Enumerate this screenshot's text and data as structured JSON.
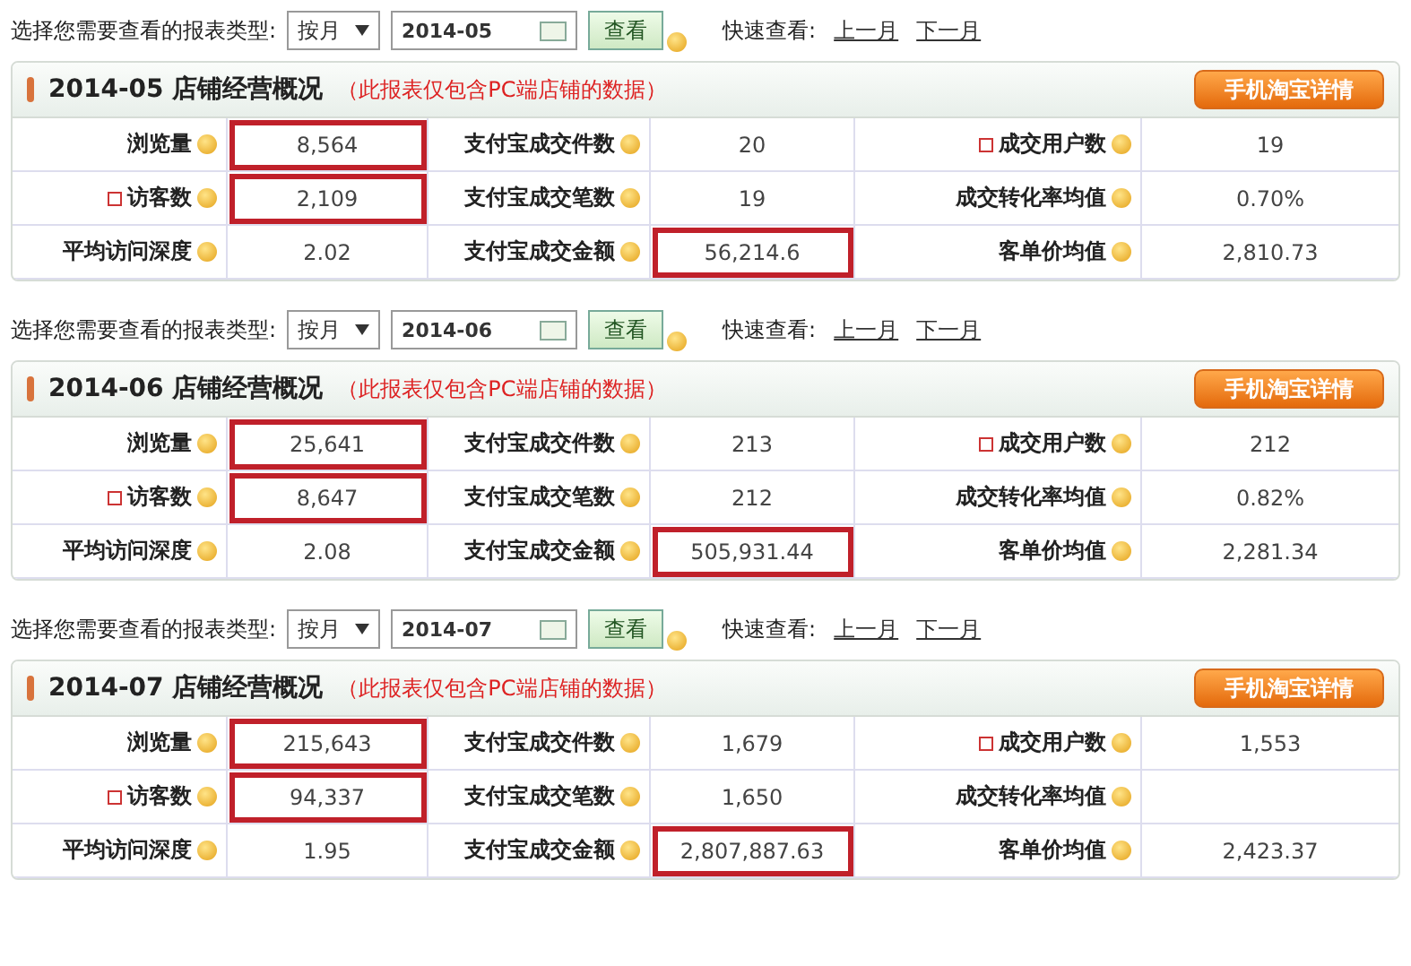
{
  "sections": [
    {
      "toolbar": {
        "label": "选择您需要查看的报表类型:",
        "period": "按月",
        "date": "2014-05",
        "view_button": "查看",
        "quick_label": "快速查看:",
        "links": [
          "上一月",
          "下一月"
        ]
      },
      "panel": {
        "title": "2014-05 店铺经营概况",
        "note": "（此报表仅包含PC端店铺的数据）",
        "mobile_button": "手机淘宝详情",
        "rows": [
          [
            {
              "label": "浏览量",
              "value": "8,564",
              "new_icon": false,
              "highlighted": true
            },
            {
              "label": "支付宝成交件数",
              "value": "20",
              "new_icon": false,
              "highlighted": false
            },
            {
              "label": "成交用户数",
              "value": "19",
              "new_icon": true,
              "highlighted": false
            }
          ],
          [
            {
              "label": "访客数",
              "value": "2,109",
              "new_icon": true,
              "highlighted": true
            },
            {
              "label": "支付宝成交笔数",
              "value": "19",
              "new_icon": false,
              "highlighted": false
            },
            {
              "label": "成交转化率均值",
              "value": "0.70%",
              "new_icon": false,
              "highlighted": false
            }
          ],
          [
            {
              "label": "平均访问深度",
              "value": "2.02",
              "new_icon": false,
              "highlighted": false
            },
            {
              "label": "支付宝成交金额",
              "value": "56,214.6",
              "new_icon": false,
              "highlighted": true
            },
            {
              "label": "客单价均值",
              "value": "2,810.73",
              "new_icon": false,
              "highlighted": false
            }
          ]
        ]
      }
    },
    {
      "toolbar": {
        "label": "选择您需要查看的报表类型:",
        "period": "按月",
        "date": "2014-06",
        "view_button": "查看",
        "quick_label": "快速查看:",
        "links": [
          "上一月",
          "下一月"
        ]
      },
      "panel": {
        "title": "2014-06 店铺经营概况",
        "note": "（此报表仅包含PC端店铺的数据）",
        "mobile_button": "手机淘宝详情",
        "rows": [
          [
            {
              "label": "浏览量",
              "value": "25,641",
              "new_icon": false,
              "highlighted": true
            },
            {
              "label": "支付宝成交件数",
              "value": "213",
              "new_icon": false,
              "highlighted": false
            },
            {
              "label": "成交用户数",
              "value": "212",
              "new_icon": true,
              "highlighted": false
            }
          ],
          [
            {
              "label": "访客数",
              "value": "8,647",
              "new_icon": true,
              "highlighted": true
            },
            {
              "label": "支付宝成交笔数",
              "value": "212",
              "new_icon": false,
              "highlighted": false
            },
            {
              "label": "成交转化率均值",
              "value": "0.82%",
              "new_icon": false,
              "highlighted": false
            }
          ],
          [
            {
              "label": "平均访问深度",
              "value": "2.08",
              "new_icon": false,
              "highlighted": false
            },
            {
              "label": "支付宝成交金额",
              "value": "505,931.44",
              "new_icon": false,
              "highlighted": true
            },
            {
              "label": "客单价均值",
              "value": "2,281.34",
              "new_icon": false,
              "highlighted": false
            }
          ]
        ]
      }
    },
    {
      "toolbar": {
        "label": "选择您需要查看的报表类型:",
        "period": "按月",
        "date": "2014-07",
        "view_button": "查看",
        "quick_label": "快速查看:",
        "links": [
          "上一月",
          "下一月"
        ]
      },
      "panel": {
        "title": "2014-07 店铺经营概况",
        "note": "（此报表仅包含PC端店铺的数据）",
        "mobile_button": "手机淘宝详情",
        "rows": [
          [
            {
              "label": "浏览量",
              "value": "215,643",
              "new_icon": false,
              "highlighted": true
            },
            {
              "label": "支付宝成交件数",
              "value": "1,679",
              "new_icon": false,
              "highlighted": false
            },
            {
              "label": "成交用户数",
              "value": "1,553",
              "new_icon": true,
              "highlighted": false
            }
          ],
          [
            {
              "label": "访客数",
              "value": "94,337",
              "new_icon": true,
              "highlighted": true
            },
            {
              "label": "支付宝成交笔数",
              "value": "1,650",
              "new_icon": false,
              "highlighted": false
            },
            {
              "label": "成交转化率均值",
              "new_icon": false,
              "highlighted": false
            }
          ],
          [
            {
              "label": "平均访问深度",
              "value": "1.95",
              "new_icon": false,
              "highlighted": false
            },
            {
              "label": "支付宝成交金额",
              "value": "2,807,887.63",
              "new_icon": false,
              "highlighted": true
            },
            {
              "label": "客单价均值",
              "value": "2,423.37",
              "new_icon": false,
              "highlighted": false
            }
          ]
        ]
      }
    }
  ]
}
